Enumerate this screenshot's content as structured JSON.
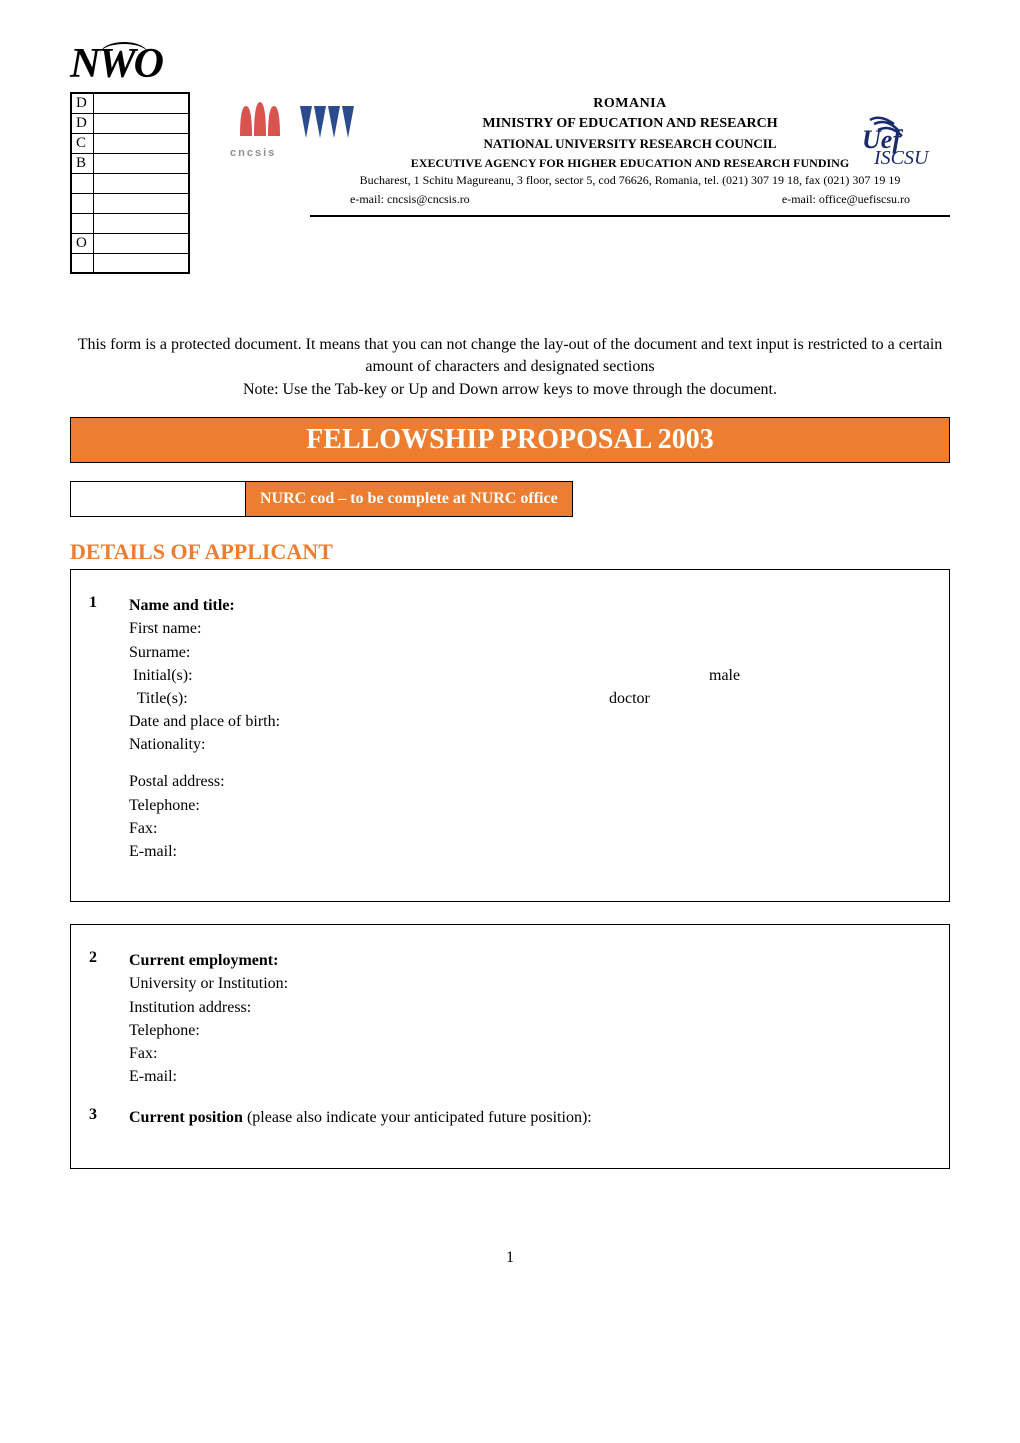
{
  "header": {
    "nwo_logo_text": "NWO",
    "small_table_rows": [
      "D",
      "D",
      "C",
      "B",
      "",
      "",
      "",
      "O",
      ""
    ],
    "romania": "ROMANIA",
    "ministry": "MINISTRY OF EDUCATION AND RESEARCH",
    "council": "NATIONAL UNIVERSITY RESEARCH COUNCIL",
    "agency": "EXECUTIVE AGENCY FOR HIGHER EDUCATION AND RESEARCH FUNDING",
    "address": "Bucharest, 1 Schitu Magureanu, 3 floor, sector 5, cod 76626, Romania, tel. (021) 307 19 18, fax (021) 307 19 19",
    "email_left": "e-mail: cncsis@cncsis.ro",
    "email_right": "e-mail: office@uefiscsu.ro",
    "cncsis_text": "cncsis"
  },
  "notice": {
    "line1": "This form is a protected document. It means that you can not change the lay-out of the document and text input is restricted to a certain amount of characters and designated sections",
    "line2": "Note: Use the Tab-key or Up and Down arrow keys to move through the document."
  },
  "title_bar": "FELLOWSHIP PROPOSAL 2003",
  "nurc": "NURC cod – to be complete at NURC office",
  "section_title": "DETAILS OF APPLICANT",
  "s1": {
    "num": "1",
    "heading": "Name and title:",
    "first_name_label": "First name:",
    "first_name_value": "",
    "surname_label": "Surname:",
    "surname_value": "",
    "initials_label": " Initial(s):",
    "initials_value": "",
    "initials_right": "male",
    "title_label": "  Title(s):",
    "title_value": "doctor",
    "dob_label": "Date and place of birth:",
    "dob_value": "",
    "nationality_label": "Nationality:",
    "nationality_value": "",
    "postal_label": "Postal address:",
    "postal_value": "",
    "tel_label": "Telephone:",
    "tel_value": "",
    "fax_label": "Fax:",
    "fax_value": "",
    "email_label": "E-mail:",
    "email_value": ""
  },
  "s2": {
    "num": "2",
    "heading": "Current employment:",
    "uni_label": "University or Institution:",
    "uni_value": "",
    "addr_label": "Institution address:",
    "addr_value": "",
    "tel_label": "Telephone:",
    "tel_value": "",
    "fax_label": "Fax:",
    "fax_value": "",
    "email_label": "E-mail:",
    "email_value": ""
  },
  "s3": {
    "num": "3",
    "heading": "Current position ",
    "note": "(please also indicate your anticipated future position):",
    "value": ""
  },
  "page_number": "1"
}
